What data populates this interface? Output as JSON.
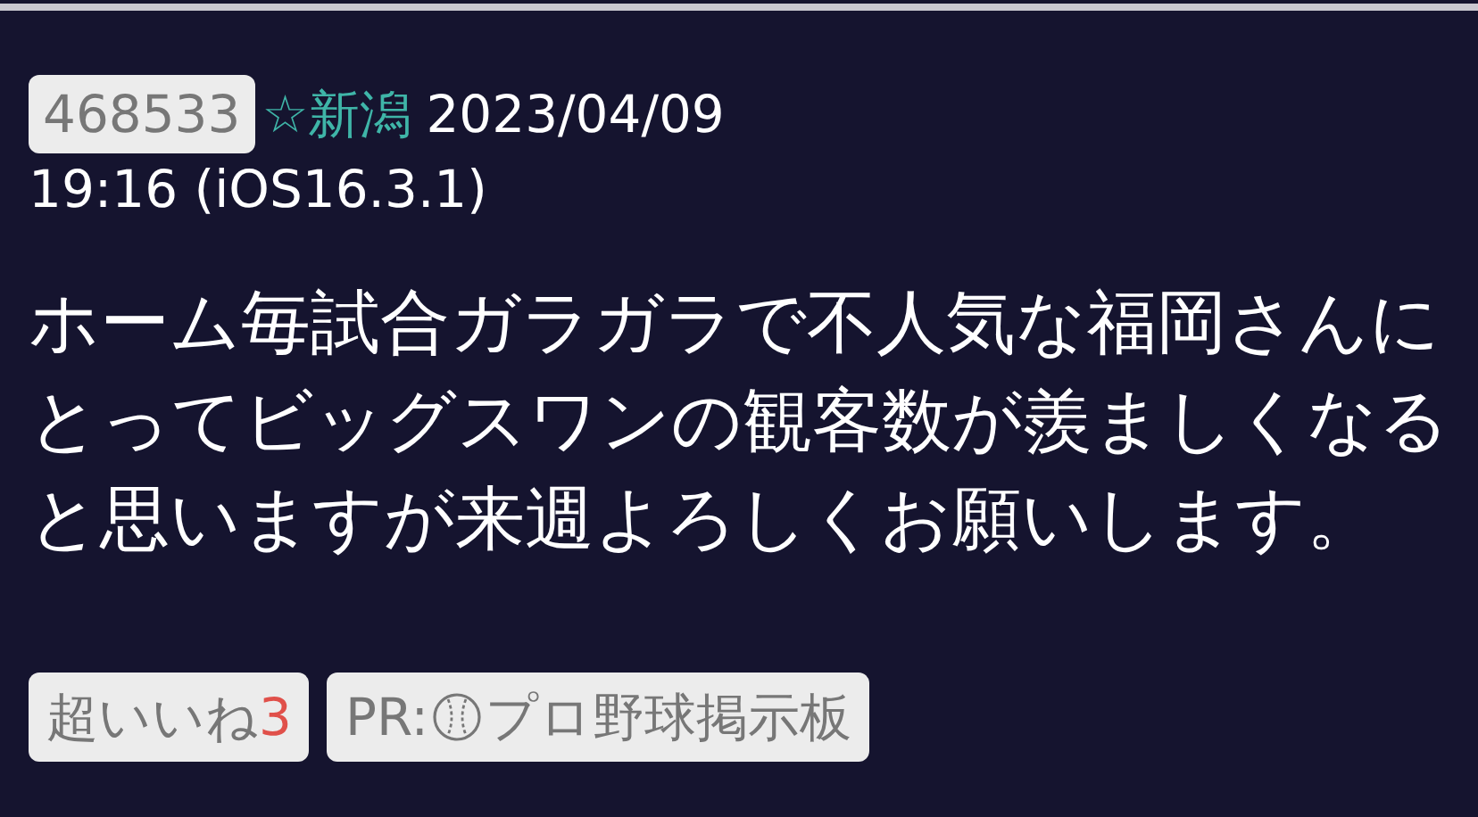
{
  "post": {
    "number": "468533",
    "author": "☆新潟",
    "date": "2023/04/09",
    "time": "19:16 (iOS16.3.1)",
    "body": "ホーム毎試合ガラガラで不人気な福岡さんにとってビッグスワンの観客数が羨ましくなると思いますが来週よろしくお願いします。"
  },
  "buttons": [
    {
      "kind": "like",
      "label": "超いいね",
      "count": "3"
    },
    {
      "kind": "ad",
      "prefix": "PR:",
      "label": "プロ野球掲示板"
    }
  ]
}
